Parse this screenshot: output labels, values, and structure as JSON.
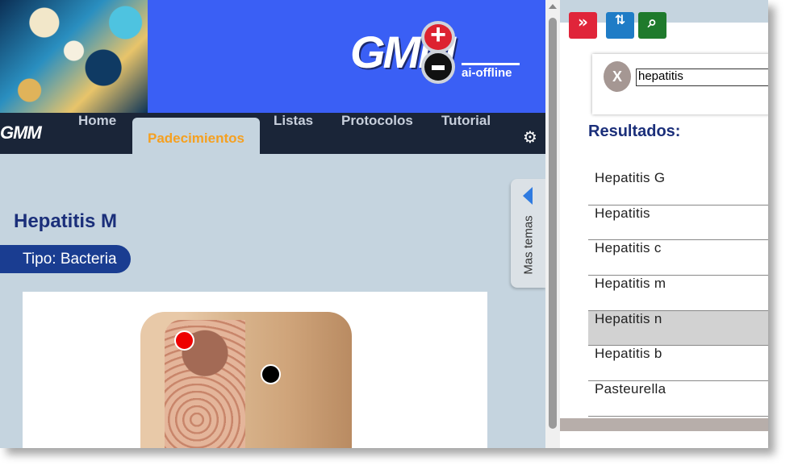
{
  "header": {
    "logo_text": "GMM",
    "logo_sub": "ai-offline",
    "nav_logo": "GMM"
  },
  "nav": {
    "items": [
      {
        "label": "Home"
      },
      {
        "label": "Padecimientos"
      },
      {
        "label": "Listas"
      },
      {
        "label": "Protocolos"
      },
      {
        "label": "Tutorial"
      }
    ],
    "active": "Padecimientos",
    "settings_icon": "gear-icon"
  },
  "main": {
    "title": "Hepatitis M",
    "type_label": "Tipo: Bacteria",
    "side_tab_label": "Mas temas",
    "markers": [
      "red",
      "black"
    ]
  },
  "panel": {
    "buttons": [
      {
        "icon": "double-chevron-right-icon",
        "color": "#e0253a"
      },
      {
        "icon": "sort-download-icon",
        "color": "#1f7cc6"
      },
      {
        "icon": "search-icon",
        "color": "#1f7a2c"
      }
    ],
    "clear_label": "X",
    "search_value": "hepatitis",
    "results_title": "Resultados:",
    "results": [
      "Hepatitis G",
      "Hepatitis",
      "Hepatitis c",
      "Hepatitis m",
      "Hepatitis n",
      "Hepatitis b",
      "Pasteurella"
    ],
    "highlighted": "Hepatitis n"
  },
  "colors": {
    "banner": "#3a5ff5",
    "navbar": "#1a2538",
    "accent_active": "#f5a020",
    "title": "#1b2f7a",
    "pill": "#1a3d91"
  }
}
